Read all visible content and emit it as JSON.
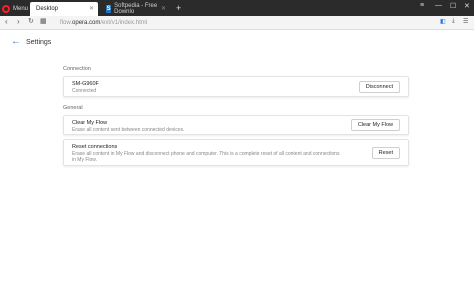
{
  "browser": {
    "menu_label": "Menu",
    "tabs": [
      {
        "label": "Desktop",
        "active": true
      },
      {
        "label": "Softpedia - Free Downlo",
        "active": false
      }
    ],
    "new_tab": "+",
    "url_prefix": "flow.",
    "url_domain": "opera.com",
    "url_suffix": "/ext/v1/index.html",
    "accent_color": "#2677e8",
    "brand_color": "#ff1b2d"
  },
  "page": {
    "title": "Settings",
    "sections": [
      {
        "label": "Connection",
        "cards": [
          {
            "title": "SM-G960F",
            "subtitle": "Connected",
            "button": "Disconnect"
          }
        ]
      },
      {
        "label": "General",
        "cards": [
          {
            "title": "Clear My Flow",
            "subtitle": "Erase all content sent between connected devices.",
            "button": "Clear My Flow"
          },
          {
            "title": "Reset connections",
            "subtitle": "Erase all content in My Flow and disconnect phone and computer. This is a complete reset of all content and connections in My Flow.",
            "button": "Reset"
          }
        ]
      }
    ]
  }
}
